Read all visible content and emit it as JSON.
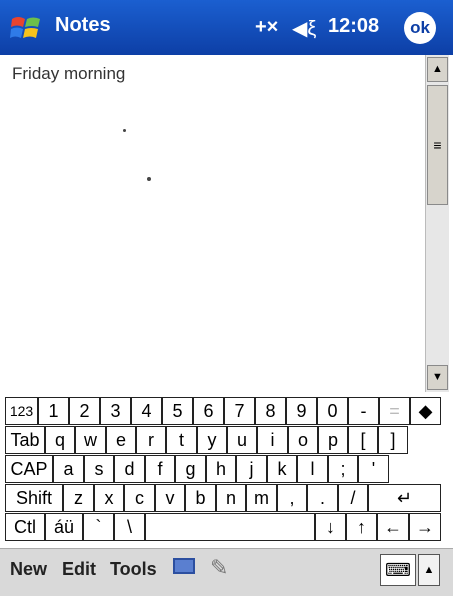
{
  "titlebar": {
    "app_title": "Notes",
    "clock": "12:08",
    "ok_label": "ok",
    "conn_glyph": "+×",
    "vol_glyph": "◀ξ",
    "start_icon": "windows-start-flag-icon"
  },
  "note": {
    "text": "Friday morning"
  },
  "scrollbar": {
    "up": "▲",
    "down": "▼",
    "thumb_glyph": "≡"
  },
  "keyboard": {
    "row1": [
      "123",
      "1",
      "2",
      "3",
      "4",
      "5",
      "6",
      "7",
      "8",
      "9",
      "0",
      "-",
      "=",
      "◆"
    ],
    "row2": [
      "Tab",
      "q",
      "w",
      "e",
      "r",
      "t",
      "y",
      "u",
      "i",
      "o",
      "p",
      "[",
      "]"
    ],
    "row3": [
      "CAP",
      "a",
      "s",
      "d",
      "f",
      "g",
      "h",
      "j",
      "k",
      "l",
      ";",
      "'"
    ],
    "row4": [
      "Shift",
      "z",
      "x",
      "c",
      "v",
      "b",
      "n",
      "m",
      ",",
      ".",
      "/",
      "↵"
    ],
    "row5": [
      "Ctl",
      "áü",
      "`",
      "\\",
      "",
      "↓",
      "↑",
      "←",
      "→"
    ]
  },
  "menubar": {
    "new": "New",
    "edit": "Edit",
    "tools": "Tools",
    "sip_glyph": "⌨",
    "sip_arrow": "▲"
  }
}
